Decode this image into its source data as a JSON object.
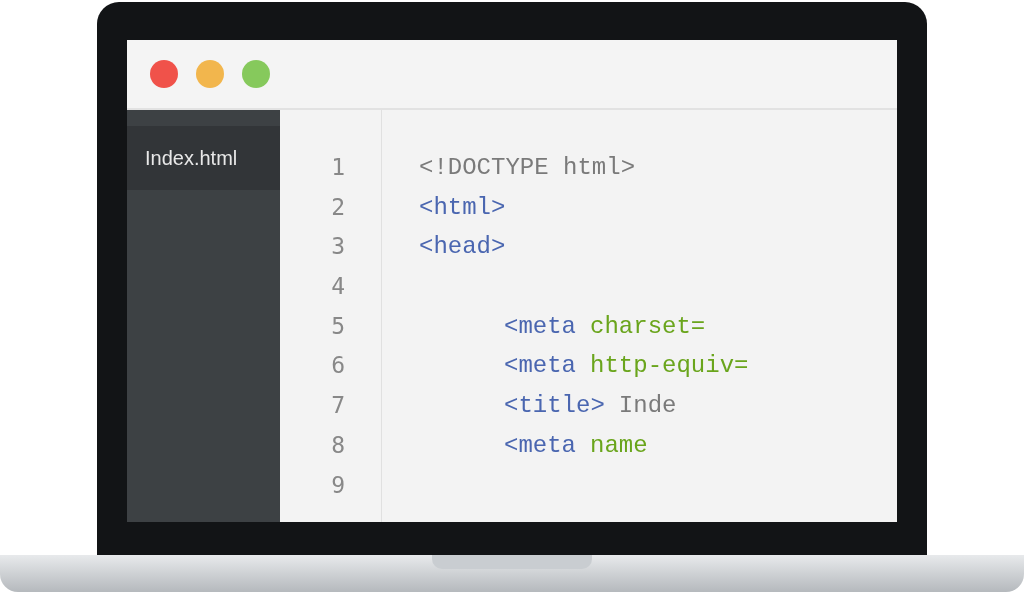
{
  "window": {
    "controls": [
      {
        "color": "#f0524a"
      },
      {
        "color": "#f2b64d"
      },
      {
        "color": "#86c95c"
      }
    ]
  },
  "sidebar": {
    "items": [
      {
        "label": "Index.html",
        "selected": true
      }
    ]
  },
  "editor": {
    "lines": [
      {
        "number": "1",
        "indented": false,
        "tokens": [
          {
            "kind": "doctype",
            "text": "<!DOCTYPE html>"
          }
        ]
      },
      {
        "number": "2",
        "indented": false,
        "tokens": [
          {
            "kind": "tag",
            "text": "<html>"
          }
        ]
      },
      {
        "number": "3",
        "indented": false,
        "tokens": [
          {
            "kind": "tag",
            "text": "<head>"
          }
        ]
      },
      {
        "number": "4"
      },
      {
        "number": "5",
        "indented": true,
        "tokens": [
          {
            "kind": "tag",
            "text": "<meta"
          },
          {
            "kind": "attr",
            "text": "charset="
          }
        ]
      },
      {
        "number": "6",
        "indented": true,
        "tokens": [
          {
            "kind": "tag",
            "text": "<meta"
          },
          {
            "kind": "attr",
            "text": "http-equiv="
          }
        ]
      },
      {
        "number": "7",
        "indented": true,
        "tokens": [
          {
            "kind": "tag",
            "text": "<title>"
          },
          {
            "kind": "text",
            "text": "Inde"
          }
        ]
      },
      {
        "number": "8",
        "indented": true,
        "tokens": [
          {
            "kind": "tag",
            "text": "<meta"
          },
          {
            "kind": "attr",
            "text": "name"
          }
        ]
      },
      {
        "number": "9"
      }
    ]
  }
}
